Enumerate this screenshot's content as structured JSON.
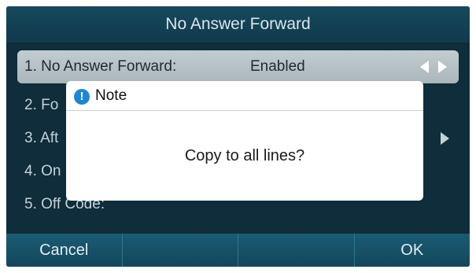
{
  "screen": {
    "title": "No Answer Forward",
    "rows": [
      {
        "label": "1. No Answer Forward:",
        "value": "Enabled",
        "selected": true
      },
      {
        "label": "2. Fo",
        "value": ""
      },
      {
        "label": "3. Aft",
        "value": ""
      },
      {
        "label": "4. On",
        "value": ""
      },
      {
        "label": "5. Off Code:",
        "value": ""
      }
    ],
    "softkeys": [
      "Cancel",
      "",
      "",
      "OK"
    ]
  },
  "dialog": {
    "title": "Note",
    "icon": "info-icon",
    "icon_glyph": "!",
    "message": "Copy to all lines?"
  },
  "colors": {
    "background": "#0f2d3a",
    "titlebar": "#16495e",
    "selected_row": "#b8c3c7",
    "softkey_bar": "#1b5c74",
    "info_icon": "#1f86d6"
  }
}
